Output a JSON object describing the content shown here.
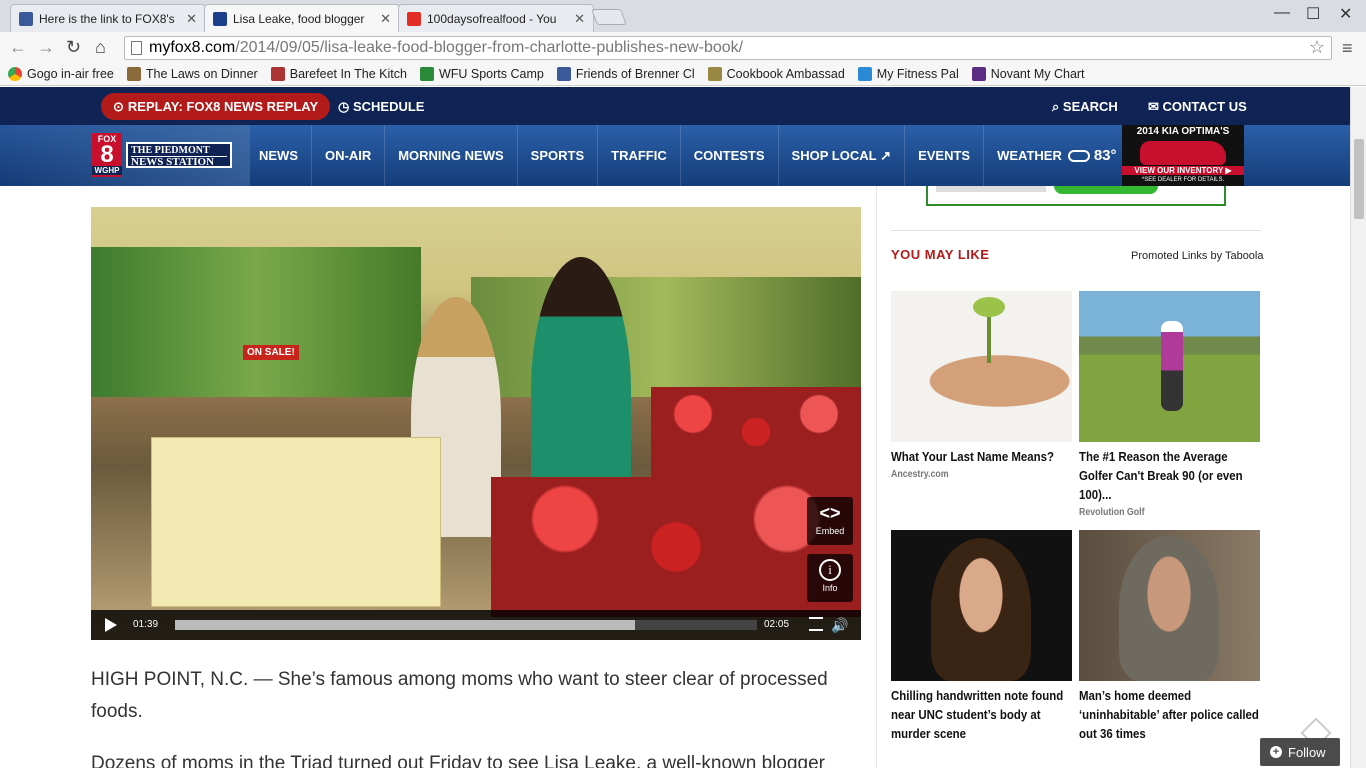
{
  "browser": {
    "tabs": [
      {
        "title": "Here is the link to FOX8's",
        "icon": "facebook-icon",
        "color": "#3b5998"
      },
      {
        "title": "Lisa Leake, food blogger",
        "icon": "fox8-icon",
        "color": "#1c3f8c"
      },
      {
        "title": "100daysofrealfood - You",
        "icon": "youtube-icon",
        "color": "#e52d27"
      }
    ],
    "url_host": "myfox8.com",
    "url_path": "/2014/09/05/lisa-leake-food-blogger-from-charlotte-publishes-new-book/",
    "bookmarks": [
      {
        "label": "Gogo in-air free",
        "icon": "chrome-icon",
        "color": "#4285f4"
      },
      {
        "label": "The Laws on Dinner",
        "icon": "bookmark-icon",
        "color": "#8a6a3a"
      },
      {
        "label": "Barefeet In The Kitch",
        "icon": "bookmark-icon",
        "color": "#a33"
      },
      {
        "label": "WFU Sports Camp",
        "icon": "bookmark-icon",
        "color": "#2a8a3a"
      },
      {
        "label": "Friends of Brenner Cl",
        "icon": "facebook-icon",
        "color": "#3b5998"
      },
      {
        "label": "Cookbook Ambassad",
        "icon": "bookmark-icon",
        "color": "#998844"
      },
      {
        "label": "My Fitness Pal",
        "icon": "bookmark-icon",
        "color": "#2a8ad6"
      },
      {
        "label": "Novant My Chart",
        "icon": "bookmark-icon",
        "color": "#5a2d82"
      }
    ]
  },
  "site": {
    "replay_label": "REPLAY:",
    "replay_rest": "FOX8 NEWS REPLAY",
    "schedule": "SCHEDULE",
    "search": "SEARCH",
    "contact": "CONTACT US",
    "logo": {
      "fox": "FOX",
      "num": "8",
      "call": "WGHP",
      "line1": "THE PIEDMONT",
      "line2": "NEWS STATION"
    },
    "nav": [
      "NEWS",
      "ON-AIR",
      "MORNING NEWS",
      "SPORTS",
      "TRAFFIC",
      "CONTESTS",
      "SHOP LOCAL",
      "EVENTS",
      "WEATHER"
    ],
    "temperature": "83°",
    "ad": {
      "line1": "2014 KIA OPTIMA'S",
      "line2": "VIEW OUR INVENTORY ▶",
      "line3": "*SEE DEALER FOR DETAILS."
    },
    "colors": {
      "topbar": "#0f2454",
      "accent_red": "#b31b1b"
    }
  },
  "video": {
    "sign": "ON SALE!",
    "current_time": "01:39",
    "total_time": "02:05",
    "progress": 0.79,
    "embed_label": "Embed",
    "info_label": "Info"
  },
  "article": {
    "lead": "HIGH POINT, N.C. — She’s famous among moms who want to steer clear of processed foods.",
    "next": "Dozens of moms in the Triad turned out Friday to see Lisa Leake, a well-known blogger"
  },
  "sidebar": {
    "heading": "YOU MAY LIKE",
    "promoted": "Promoted Links by Taboola",
    "cards": [
      {
        "title": "What Your Last Name Means?",
        "source": "Ancestry.com"
      },
      {
        "title": "The #1 Reason the Average Golfer Can't Break 90 (or even 100)...",
        "source": "Revolution Golf"
      },
      {
        "title": "Chilling handwritten note found near UNC student’s body at murder scene",
        "source": ""
      },
      {
        "title": "Man’s home deemed ‘uninhabitable’ after police called out 36 times",
        "source": ""
      }
    ]
  },
  "follow_label": "Follow"
}
